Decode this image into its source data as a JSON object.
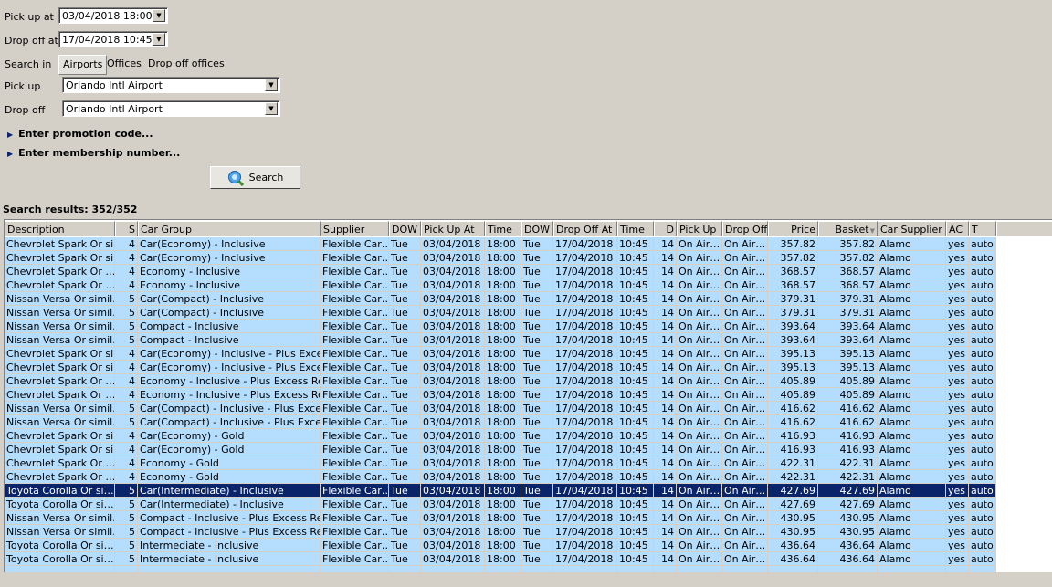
{
  "form": {
    "pickup_at_label": "Pick up at",
    "pickup_at_value": "03/04/2018 18:00",
    "dropoff_at_label": "Drop off at",
    "dropoff_at_value": "17/04/2018 10:45",
    "search_in_label": "Search in",
    "tabs": [
      {
        "label": "Airports",
        "active": true
      },
      {
        "label": "Offices"
      },
      {
        "label": "Drop off offices"
      }
    ],
    "pickup_label": "Pick up",
    "pickup_value": "Orlando Intl Airport",
    "dropoff_label": "Drop off",
    "dropoff_value": "Orlando Intl Airport",
    "promo_label": "Enter promotion code...",
    "membership_label": "Enter membership number...",
    "search_button": "Search",
    "search_icon": "globe-magnifier-icon"
  },
  "results_label": "Search results: 352/352",
  "selection_color": "#0a246a",
  "row_color": "#b5defe",
  "table": {
    "columns": [
      "Description",
      "S",
      "Car Group",
      "Supplier",
      "DOW",
      "Pick Up At",
      "Time",
      "DOW",
      "Drop Off At",
      "Time",
      "D",
      "Pick Up",
      "Drop Off",
      "Price",
      "Basket",
      "Car Supplier",
      "AC",
      "T"
    ],
    "sort_column": "Basket",
    "sort_direction": "descending-arrow",
    "selected_row": 18,
    "rows": [
      [
        "Chevrolet Spark Or si…",
        "4",
        "Car(Economy) - Inclusive",
        "Flexible Car…",
        "Tue",
        "03/04/2018",
        "18:00",
        "Tue",
        "17/04/2018",
        "10:45",
        "14",
        "On Air…",
        "On Air…",
        "357.82",
        "357.82",
        "Alamo",
        "yes",
        "auto"
      ],
      [
        "Chevrolet Spark Or si…",
        "4",
        "Car(Economy) - Inclusive",
        "Flexible Car…",
        "Tue",
        "03/04/2018",
        "18:00",
        "Tue",
        "17/04/2018",
        "10:45",
        "14",
        "On Air…",
        "On Air…",
        "357.82",
        "357.82",
        "Alamo",
        "yes",
        "auto"
      ],
      [
        "Chevrolet  Spark Or …",
        "4",
        "Economy - Inclusive",
        "Flexible Car…",
        "Tue",
        "03/04/2018",
        "18:00",
        "Tue",
        "17/04/2018",
        "10:45",
        "14",
        "On Air…",
        "On Air…",
        "368.57",
        "368.57",
        "Alamo",
        "yes",
        "auto"
      ],
      [
        "Chevrolet  Spark Or …",
        "4",
        "Economy - Inclusive",
        "Flexible Car…",
        "Tue",
        "03/04/2018",
        "18:00",
        "Tue",
        "17/04/2018",
        "10:45",
        "14",
        "On Air…",
        "On Air…",
        "368.57",
        "368.57",
        "Alamo",
        "yes",
        "auto"
      ],
      [
        "Nissan Versa Or simil…",
        "5",
        "Car(Compact) - Inclusive",
        "Flexible Car…",
        "Tue",
        "03/04/2018",
        "18:00",
        "Tue",
        "17/04/2018",
        "10:45",
        "14",
        "On Air…",
        "On Air…",
        "379.31",
        "379.31",
        "Alamo",
        "yes",
        "auto"
      ],
      [
        "Nissan Versa Or simil…",
        "5",
        "Car(Compact) - Inclusive",
        "Flexible Car…",
        "Tue",
        "03/04/2018",
        "18:00",
        "Tue",
        "17/04/2018",
        "10:45",
        "14",
        "On Air…",
        "On Air…",
        "379.31",
        "379.31",
        "Alamo",
        "yes",
        "auto"
      ],
      [
        "Nissan Versa Or simil…",
        "5",
        "Compact - Inclusive",
        "Flexible Car…",
        "Tue",
        "03/04/2018",
        "18:00",
        "Tue",
        "17/04/2018",
        "10:45",
        "14",
        "On Air…",
        "On Air…",
        "393.64",
        "393.64",
        "Alamo",
        "yes",
        "auto"
      ],
      [
        "Nissan Versa Or simil…",
        "5",
        "Compact - Inclusive",
        "Flexible Car…",
        "Tue",
        "03/04/2018",
        "18:00",
        "Tue",
        "17/04/2018",
        "10:45",
        "14",
        "On Air…",
        "On Air…",
        "393.64",
        "393.64",
        "Alamo",
        "yes",
        "auto"
      ],
      [
        "Chevrolet Spark Or si…",
        "4",
        "Car(Economy) - Inclusive - Plus Exces…",
        "Flexible Car…",
        "Tue",
        "03/04/2018",
        "18:00",
        "Tue",
        "17/04/2018",
        "10:45",
        "14",
        "On Air…",
        "On Air…",
        "395.13",
        "395.13",
        "Alamo",
        "yes",
        "auto"
      ],
      [
        "Chevrolet Spark Or si…",
        "4",
        "Car(Economy) - Inclusive - Plus Exces…",
        "Flexible Car…",
        "Tue",
        "03/04/2018",
        "18:00",
        "Tue",
        "17/04/2018",
        "10:45",
        "14",
        "On Air…",
        "On Air…",
        "395.13",
        "395.13",
        "Alamo",
        "yes",
        "auto"
      ],
      [
        "Chevrolet  Spark Or …",
        "4",
        "Economy - Inclusive - Plus Excess Ref…",
        "Flexible Car…",
        "Tue",
        "03/04/2018",
        "18:00",
        "Tue",
        "17/04/2018",
        "10:45",
        "14",
        "On Air…",
        "On Air…",
        "405.89",
        "405.89",
        "Alamo",
        "yes",
        "auto"
      ],
      [
        "Chevrolet  Spark Or …",
        "4",
        "Economy - Inclusive - Plus Excess Ref…",
        "Flexible Car…",
        "Tue",
        "03/04/2018",
        "18:00",
        "Tue",
        "17/04/2018",
        "10:45",
        "14",
        "On Air…",
        "On Air…",
        "405.89",
        "405.89",
        "Alamo",
        "yes",
        "auto"
      ],
      [
        "Nissan Versa Or simil…",
        "5",
        "Car(Compact) - Inclusive - Plus Exces…",
        "Flexible Car…",
        "Tue",
        "03/04/2018",
        "18:00",
        "Tue",
        "17/04/2018",
        "10:45",
        "14",
        "On Air…",
        "On Air…",
        "416.62",
        "416.62",
        "Alamo",
        "yes",
        "auto"
      ],
      [
        "Nissan Versa Or simil…",
        "5",
        "Car(Compact) - Inclusive - Plus Exces…",
        "Flexible Car…",
        "Tue",
        "03/04/2018",
        "18:00",
        "Tue",
        "17/04/2018",
        "10:45",
        "14",
        "On Air…",
        "On Air…",
        "416.62",
        "416.62",
        "Alamo",
        "yes",
        "auto"
      ],
      [
        "Chevrolet Spark Or si…",
        "4",
        "Car(Economy) - Gold",
        "Flexible Car…",
        "Tue",
        "03/04/2018",
        "18:00",
        "Tue",
        "17/04/2018",
        "10:45",
        "14",
        "On Air…",
        "On Air…",
        "416.93",
        "416.93",
        "Alamo",
        "yes",
        "auto"
      ],
      [
        "Chevrolet Spark Or si…",
        "4",
        "Car(Economy) - Gold",
        "Flexible Car…",
        "Tue",
        "03/04/2018",
        "18:00",
        "Tue",
        "17/04/2018",
        "10:45",
        "14",
        "On Air…",
        "On Air…",
        "416.93",
        "416.93",
        "Alamo",
        "yes",
        "auto"
      ],
      [
        "Chevrolet  Spark Or …",
        "4",
        "Economy - Gold",
        "Flexible Car…",
        "Tue",
        "03/04/2018",
        "18:00",
        "Tue",
        "17/04/2018",
        "10:45",
        "14",
        "On Air…",
        "On Air…",
        "422.31",
        "422.31",
        "Alamo",
        "yes",
        "auto"
      ],
      [
        "Chevrolet  Spark Or …",
        "4",
        "Economy - Gold",
        "Flexible Car…",
        "Tue",
        "03/04/2018",
        "18:00",
        "Tue",
        "17/04/2018",
        "10:45",
        "14",
        "On Air…",
        "On Air…",
        "422.31",
        "422.31",
        "Alamo",
        "yes",
        "auto"
      ],
      [
        "Toyota Corolla Or si…",
        "5",
        "Car(Intermediate) - Inclusive",
        "Flexible Car…",
        "Tue",
        "03/04/2018",
        "18:00",
        "Tue",
        "17/04/2018",
        "10:45",
        "14",
        "On Air…",
        "On Air…",
        "427.69",
        "427.69",
        "Alamo",
        "yes",
        "auto"
      ],
      [
        "Toyota Corolla Or si…",
        "5",
        "Car(Intermediate) - Inclusive",
        "Flexible Car…",
        "Tue",
        "03/04/2018",
        "18:00",
        "Tue",
        "17/04/2018",
        "10:45",
        "14",
        "On Air…",
        "On Air…",
        "427.69",
        "427.69",
        "Alamo",
        "yes",
        "auto"
      ],
      [
        "Nissan Versa Or simil…",
        "5",
        "Compact - Inclusive - Plus Excess Ref…",
        "Flexible Car…",
        "Tue",
        "03/04/2018",
        "18:00",
        "Tue",
        "17/04/2018",
        "10:45",
        "14",
        "On Air…",
        "On Air…",
        "430.95",
        "430.95",
        "Alamo",
        "yes",
        "auto"
      ],
      [
        "Nissan Versa Or simil…",
        "5",
        "Compact - Inclusive - Plus Excess Ref…",
        "Flexible Car…",
        "Tue",
        "03/04/2018",
        "18:00",
        "Tue",
        "17/04/2018",
        "10:45",
        "14",
        "On Air…",
        "On Air…",
        "430.95",
        "430.95",
        "Alamo",
        "yes",
        "auto"
      ],
      [
        "Toyota Corolla Or si…",
        "5",
        "Intermediate - Inclusive",
        "Flexible Car…",
        "Tue",
        "03/04/2018",
        "18:00",
        "Tue",
        "17/04/2018",
        "10:45",
        "14",
        "On Air…",
        "On Air…",
        "436.64",
        "436.64",
        "Alamo",
        "yes",
        "auto"
      ],
      [
        "Toyota Corolla Or si…",
        "5",
        "Intermediate - Inclusive",
        "Flexible Car…",
        "Tue",
        "03/04/2018",
        "18:00",
        "Tue",
        "17/04/2018",
        "10:45",
        "14",
        "On Air…",
        "On Air…",
        "436.64",
        "436.64",
        "Alamo",
        "yes",
        "auto"
      ]
    ]
  }
}
